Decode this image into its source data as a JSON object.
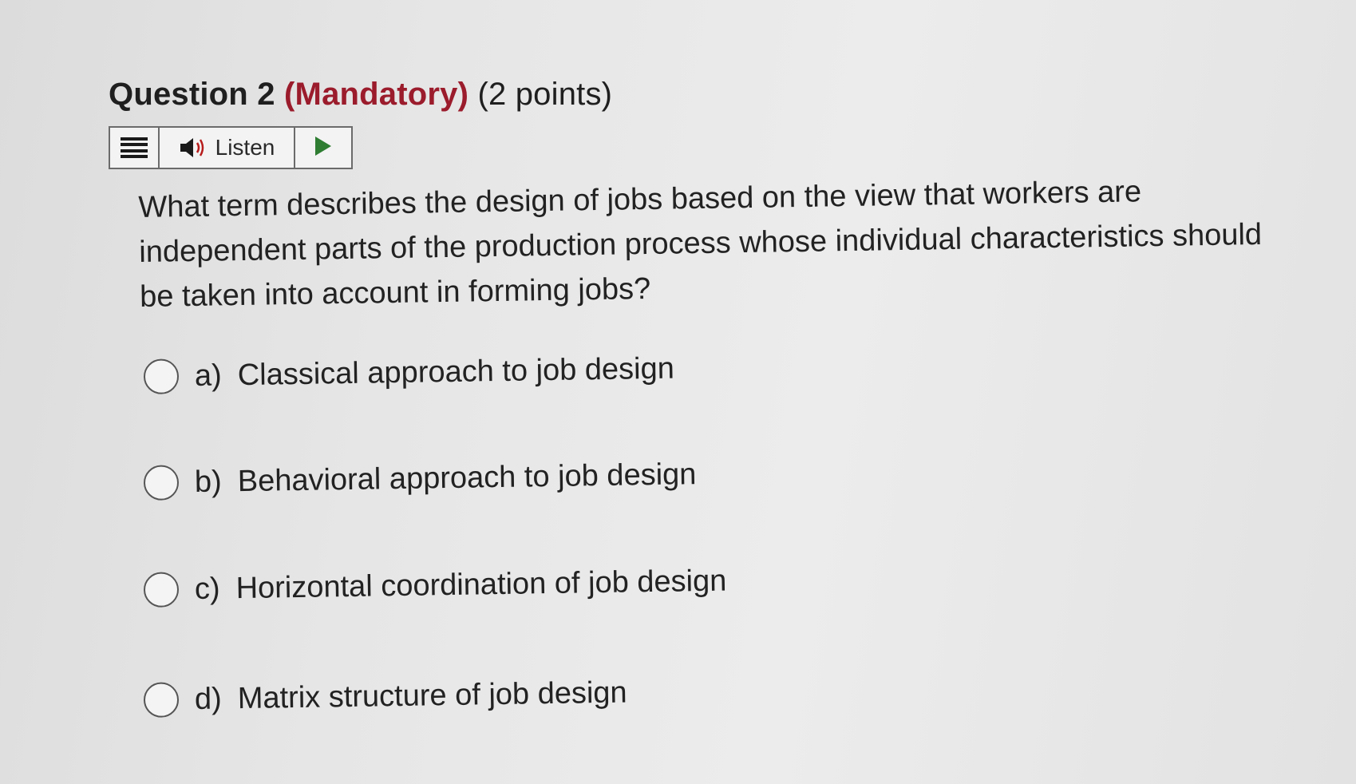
{
  "question": {
    "title": "Question 2",
    "mandatory": "(Mandatory)",
    "points": "(2 points)",
    "text": "What term describes the design of jobs based on the view that workers are independent parts of the production process whose individual characteristics should be taken into account in forming jobs?"
  },
  "listen_bar": {
    "menu_icon": "hamburger-menu-icon",
    "speaker_icon": "speaker-icon",
    "listen_label": "Listen",
    "play_icon": "play-icon",
    "play_color": "#2e7d32"
  },
  "options": [
    {
      "letter": "a)",
      "text": "Classical approach to job design",
      "selected": false
    },
    {
      "letter": "b)",
      "text": "Behavioral approach to job design",
      "selected": false
    },
    {
      "letter": "c)",
      "text": "Horizontal coordination of job design",
      "selected": false
    },
    {
      "letter": "d)",
      "text": "Matrix structure of job design",
      "selected": false
    }
  ],
  "colors": {
    "mandatory": "#9b1c2c",
    "text": "#222222"
  }
}
